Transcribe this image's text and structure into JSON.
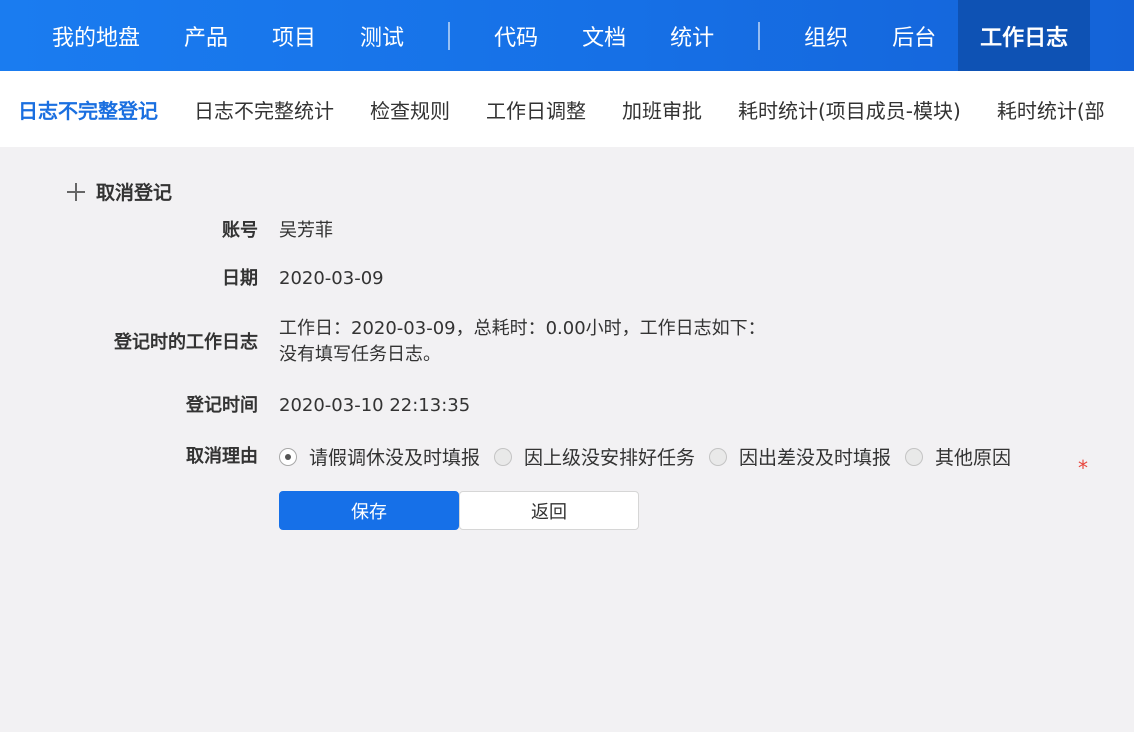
{
  "topnav": {
    "items": [
      "我的地盘",
      "产品",
      "项目",
      "测试",
      "代码",
      "文档",
      "统计",
      "组织",
      "后台",
      "工作日志"
    ],
    "active": "工作日志"
  },
  "subnav": {
    "items": [
      "日志不完整登记",
      "日志不完整统计",
      "检查规则",
      "工作日调整",
      "加班审批",
      "耗时统计(项目成员-模块)",
      "耗时统计(部"
    ],
    "active": "日志不完整登记"
  },
  "form": {
    "title": "取消登记",
    "account_label": "账号",
    "account_value": "吴芳菲",
    "date_label": "日期",
    "date_value": "2020-03-09",
    "log_label": "登记时的工作日志",
    "log_line1": "工作日：2020-03-09，总耗时：0.00小时，工作日志如下：",
    "log_line2": "没有填写任务日志。",
    "regtime_label": "登记时间",
    "regtime_value": "2020-03-10 22:13:35",
    "reason_label": "取消理由",
    "reasons": [
      "请假调休没及时填报",
      "因上级没安排好任务",
      "因出差没及时填报",
      "其他原因"
    ],
    "selected_reason": "请假调休没及时填报",
    "required_mark": "*",
    "save_label": "保存",
    "back_label": "返回"
  },
  "colors": {
    "nav_blue": "#1a7cf0",
    "active_tab_dark": "#0e52b4",
    "accent_blue": "#1670e8",
    "required_red": "#e8453c",
    "page_bg": "#f2f1f3"
  },
  "icons": {
    "title_icon": "plus-icon"
  }
}
